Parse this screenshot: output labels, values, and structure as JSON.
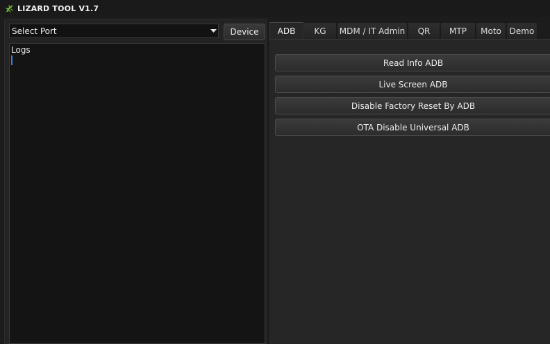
{
  "window": {
    "title": "LIZARD TOOL V1.7",
    "icon": "lizard-icon",
    "accent_color": "#6fbf3a"
  },
  "left": {
    "port_select": {
      "value": "Select Port",
      "icon": "chevron-down-icon"
    },
    "device_button": "Device",
    "logs": {
      "label": "Logs",
      "cursor_color": "#3b82d6"
    }
  },
  "right": {
    "tabs": [
      {
        "label": "ADB",
        "active": true
      },
      {
        "label": "KG",
        "active": false
      },
      {
        "label": "MDM / IT Admin",
        "active": false
      },
      {
        "label": "QR",
        "active": false
      },
      {
        "label": "MTP",
        "active": false
      },
      {
        "label": "Moto",
        "active": false
      },
      {
        "label": "Demo",
        "active": false
      }
    ],
    "actions": [
      {
        "label": "Read Info ADB"
      },
      {
        "label": "Live Screen ADB"
      },
      {
        "label": "Disable Factory Reset By ADB"
      },
      {
        "label": "OTA Disable Universal ADB"
      }
    ]
  }
}
